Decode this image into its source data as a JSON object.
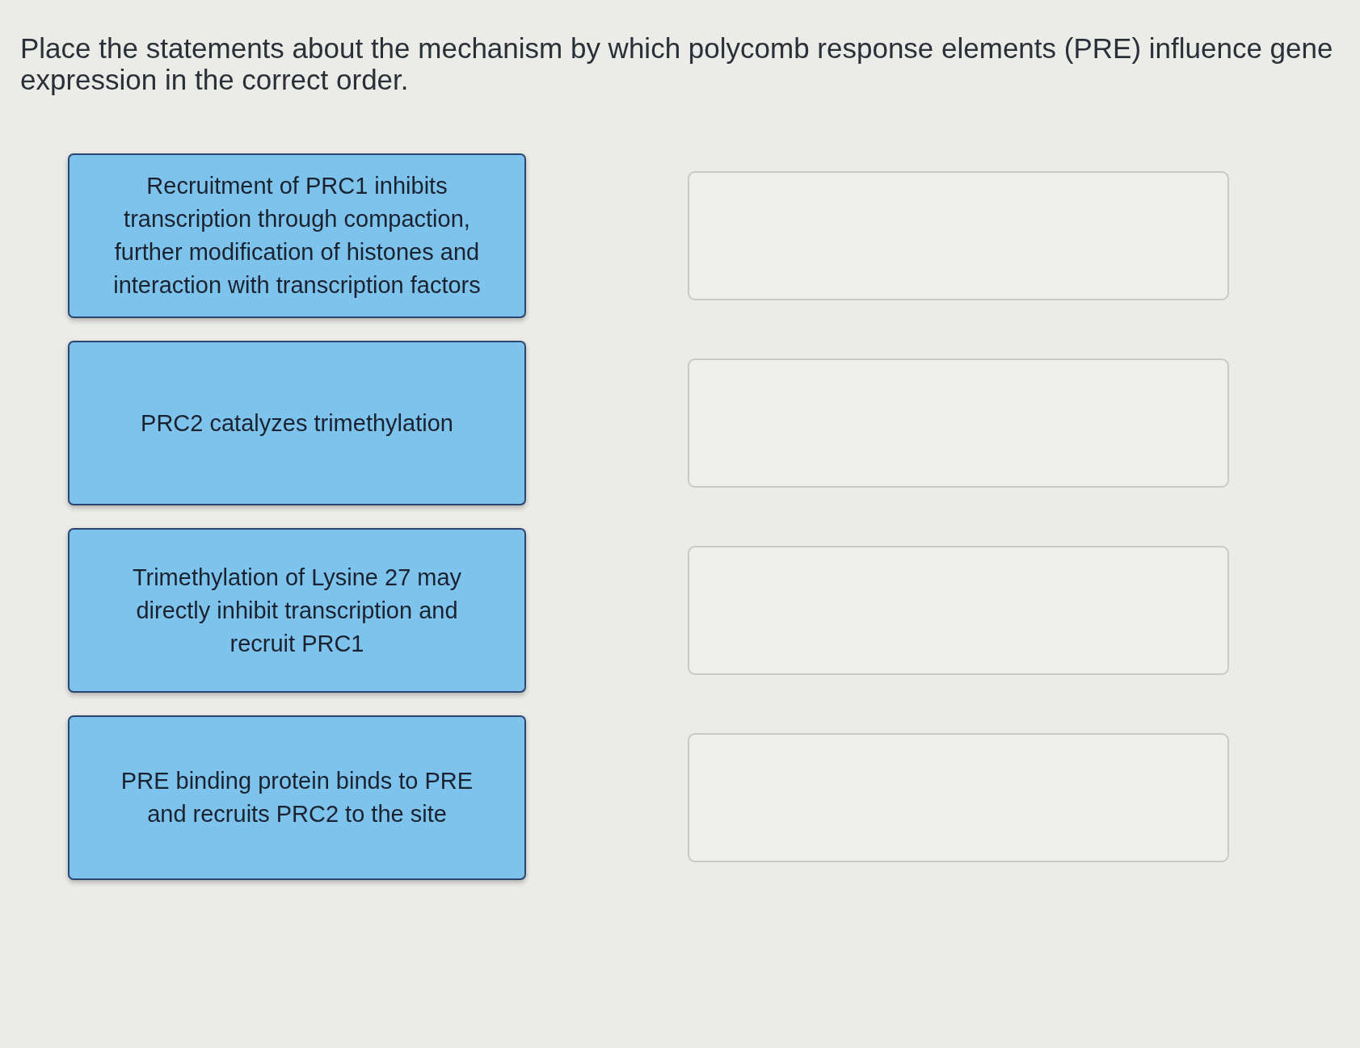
{
  "question": "Place the statements about the mechanism by which polycomb response elements (PRE) influence gene expression in the correct order.",
  "statements": [
    {
      "text": "Recruitment of PRC1 inhibits transcription through compaction, further modification of histones and interaction with transcription factors"
    },
    {
      "text": "PRC2 catalyzes trimethylation"
    },
    {
      "text": "Trimethylation of Lysine 27 may directly inhibit transcription and recruit PRC1"
    },
    {
      "text": "PRE binding protein binds to PRE and recruits PRC2 to the site"
    }
  ],
  "answer_slots": [
    {
      "filled": false
    },
    {
      "filled": false
    },
    {
      "filled": false
    },
    {
      "filled": false
    }
  ]
}
